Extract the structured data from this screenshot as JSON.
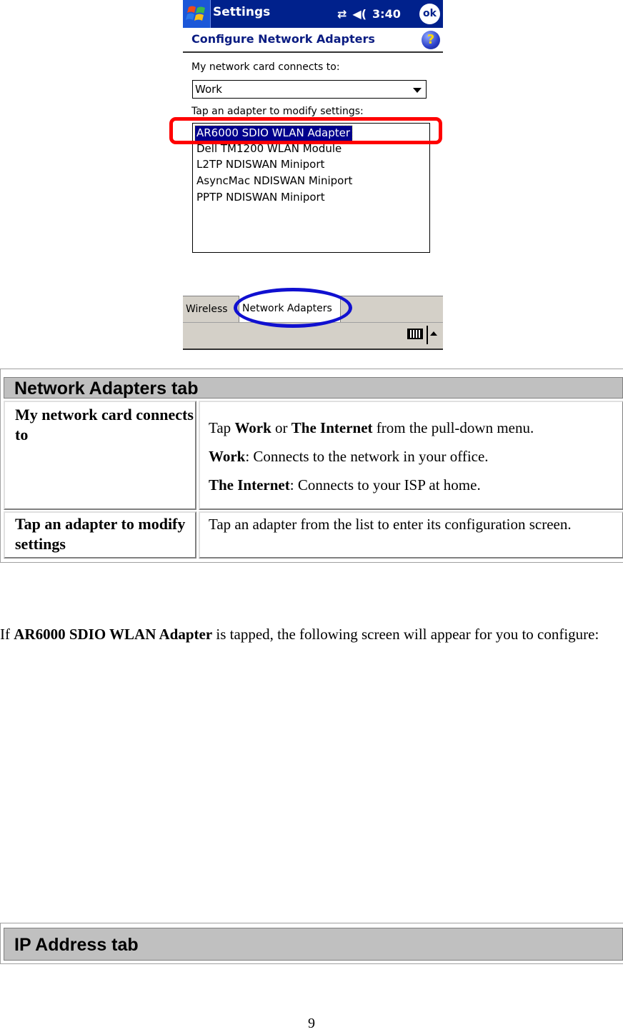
{
  "pda": {
    "titlebar": {
      "app_title": "Settings",
      "time": "3:40",
      "ok_label": "ok",
      "start_icon": "windows-flag-icon",
      "connectivity_icon": "connectivity-arrows-icon",
      "volume_icon": "speaker-icon",
      "connectivity_glyph": "⇄",
      "volume_glyph": "◀("
    },
    "page_header": {
      "title": "Configure Network Adapters",
      "help_glyph": "?"
    },
    "connects_to": {
      "label": "My network card connects to:",
      "selected": "Work"
    },
    "adapter_list": {
      "label": "Tap an adapter to modify settings:",
      "items": [
        {
          "name": "AR6000 SDIO WLAN Adapter",
          "selected": true
        },
        {
          "name": "Dell TM1200 WLAN Module",
          "selected": false
        },
        {
          "name": "L2TP NDISWAN Miniport",
          "selected": false
        },
        {
          "name": "AsyncMac NDISWAN Miniport",
          "selected": false
        },
        {
          "name": "PPTP NDISWAN Miniport",
          "selected": false
        }
      ]
    },
    "tabs": [
      {
        "label": "Wireless",
        "active": false
      },
      {
        "label": "Network Adapters",
        "active": true
      }
    ],
    "annotation_colors": {
      "red_box": "#ff0000",
      "blue_ellipse": "#1010d0"
    }
  },
  "network_adapters_table": {
    "header": "Network Adapters tab",
    "rows": [
      {
        "label": "My network card connects to",
        "lines": [
          {
            "parts": [
              {
                "t": "Tap ",
                "b": false
              },
              {
                "t": "Work",
                "b": true
              },
              {
                "t": " or ",
                "b": false
              },
              {
                "t": "The Internet",
                "b": true
              },
              {
                "t": " from the pull-down menu.",
                "b": false
              }
            ]
          },
          {
            "parts": [
              {
                "t": "Work",
                "b": true
              },
              {
                "t": ": Connects to the network in your office.",
                "b": false
              }
            ]
          },
          {
            "parts": [
              {
                "t": "The Internet",
                "b": true
              },
              {
                "t": ": Connects to your ISP at home.",
                "b": false
              }
            ]
          }
        ]
      },
      {
        "label": "Tap an adapter to modify settings",
        "lines": [
          {
            "parts": [
              {
                "t": "Tap an adapter from the list to enter its configuration screen.",
                "b": false
              }
            ]
          }
        ]
      }
    ]
  },
  "paragraph": {
    "prefix": "If ",
    "bold": "AR6000 SDIO WLAN Adapter",
    "suffix": " is tapped, the following screen will appear for you to configure:"
  },
  "ip_address_table": {
    "header": "IP Address tab"
  },
  "page_number": "9"
}
